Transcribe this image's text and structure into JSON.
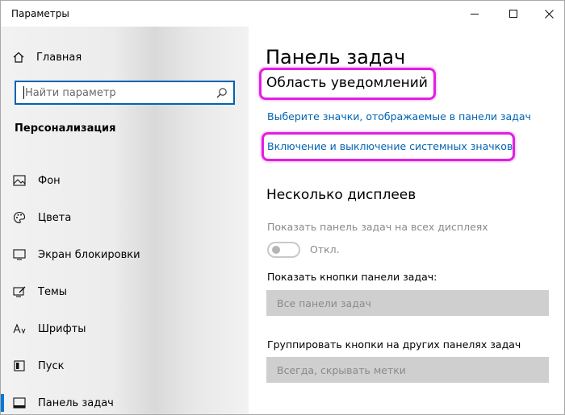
{
  "window": {
    "title": "Параметры"
  },
  "sidebar": {
    "home_label": "Главная",
    "search": {
      "placeholder": "Найти параметр"
    },
    "section_header": "Персонализация",
    "items": [
      {
        "label": "Фон",
        "icon": "image-icon"
      },
      {
        "label": "Цвета",
        "icon": "palette-icon"
      },
      {
        "label": "Экран блокировки",
        "icon": "lock-screen-icon"
      },
      {
        "label": "Темы",
        "icon": "themes-icon"
      },
      {
        "label": "Шрифты",
        "icon": "fonts-icon"
      },
      {
        "label": "Пуск",
        "icon": "start-icon"
      },
      {
        "label": "Панель задач",
        "icon": "taskbar-icon",
        "active": true
      }
    ]
  },
  "main": {
    "page_title": "Панель задач",
    "notification_area": {
      "title": "Область уведомлений",
      "link_icons": "Выберите значки, отображаемые в панели задач",
      "link_system_icons": "Включение и выключение системных значков"
    },
    "multiple_displays": {
      "title": "Несколько дисплеев",
      "show_all_label": "Показать панель задач на всех дисплеях",
      "toggle_state": "Откл.",
      "toggle_on": false,
      "show_buttons_label": "Показать кнопки панели задач:",
      "show_buttons_value": "Все панели задач",
      "combine_label": "Группировать кнопки на других панелях задач",
      "combine_value": "Всегда, скрывать метки"
    }
  },
  "colors": {
    "accent": "#0078d7",
    "link": "#0063b1",
    "highlight": "#e21fe2"
  }
}
